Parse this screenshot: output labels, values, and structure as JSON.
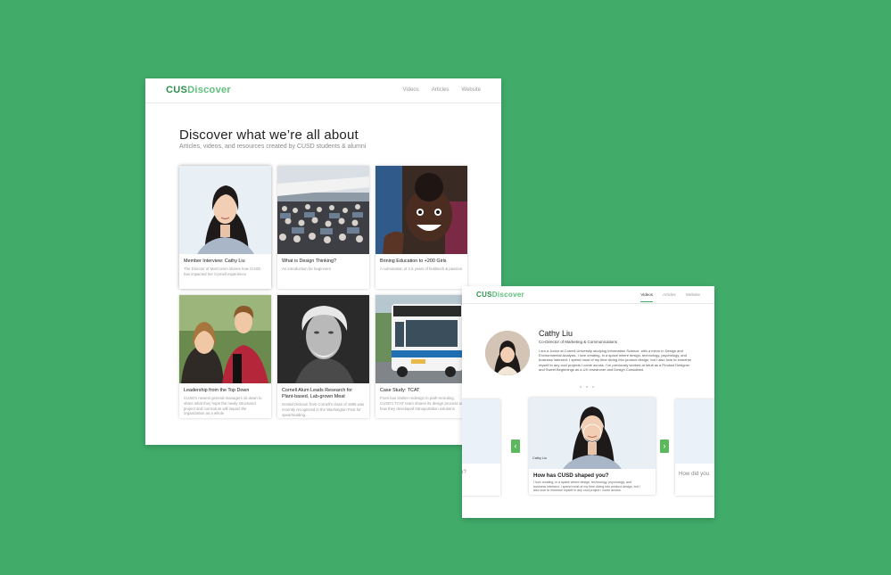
{
  "main": {
    "logo_bold": "CUS",
    "logo_accent": "Discover",
    "nav": [
      "Videos",
      "Articles",
      "Website"
    ],
    "title": "Discover what we’re all about",
    "subtitle": "Articles, videos, and resources created by CUSD students & alumni",
    "cards": [
      {
        "title": "Member Interview: Cathy Liu",
        "desc": "The Director of MarComm shares how CUSD has impacted her Cornell experience"
      },
      {
        "title": "What is Design Thinking?",
        "desc": "An introduction for beginners"
      },
      {
        "title": "Brining Education to +200 Girls",
        "desc": "A culmination of 2.5 years of fieldwork & passion"
      },
      {
        "title": "Leadership from the Top Down",
        "desc": "CUSD's newest general managers sit down to share what they hope the newly structured project and curriculum will impact the organization as a whole"
      },
      {
        "title": "Cornell Alum Leads Research for Plant-based, Lab-grown Meat",
        "desc": "Gerald Dickson from Cornell's class of 1985 was recently recognized in the Washington Post for spearheading..."
      },
      {
        "title": "Case Study: TCAT",
        "desc": "From bus shelter redesign to path-rerouting, CUSD's TCAT team shares its design process on how they developed transportation solutions"
      }
    ]
  },
  "second": {
    "logo_bold": "CUS",
    "logo_accent": "Discover",
    "nav": [
      "Videos",
      "Articles",
      "Website"
    ],
    "active_nav": "Videos",
    "profile": {
      "name": "Cathy Liu",
      "role": "Co-Director of Marketing & Communications",
      "bio": "I am a Junior at Cornell University studying Information Science, with a minor in Design and Environmental Analysis. I love creating, in a space where design, technology, psychology, and business intersect. I spend most of my time diving into product design, but I also love to immerse myself in any cool projects I come across. I've previously worked at Intuit as a Product Designer and Sweet Beginnings as a UX researcher and Design Consultant."
    },
    "prev_label": "‹",
    "next_label": "›",
    "card_tag": "Cathy Liu",
    "card_question": "How has CUSD shaped you?",
    "card_text": "I love creating, in a space where design, technology, psychology, and business intersect. I spend most of my time diving into product design, but I also love to immerse myself in any cool project I come across.",
    "left_peek": "u?",
    "right_peek": "How did you"
  },
  "colors": {
    "background": "#41ab6a",
    "brand": "#2f8e4d",
    "accent": "#5cc07a",
    "arrow": "#5cb85c"
  }
}
